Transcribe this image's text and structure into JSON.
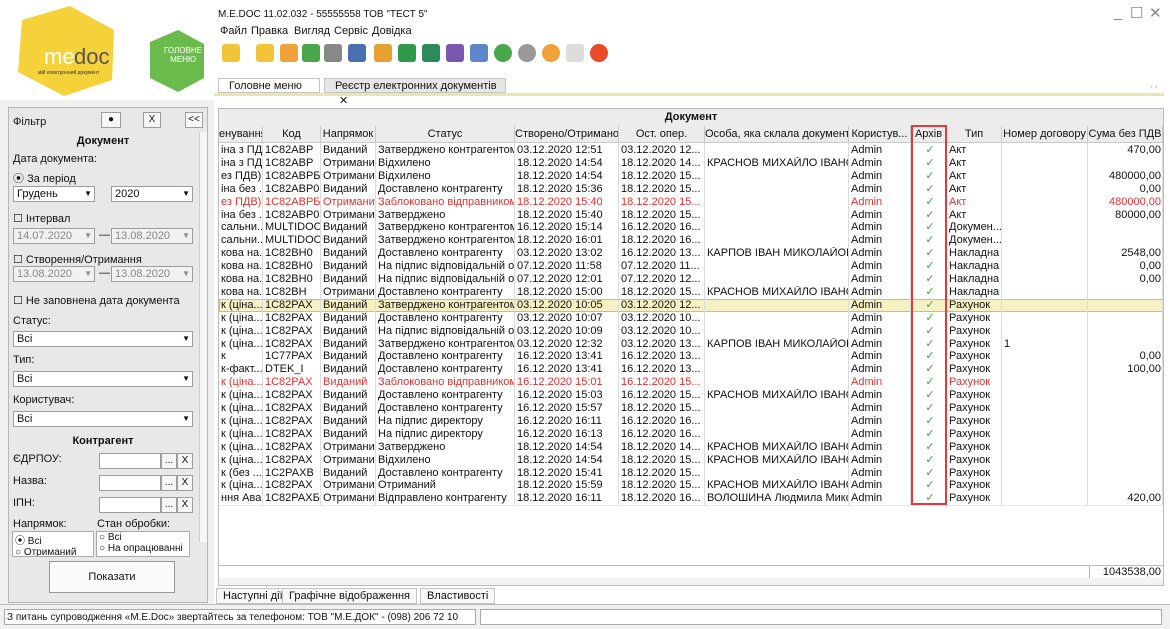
{
  "app": {
    "title": "M.E.DOC 11.02.032 - 55555558 ТОВ \"ТЕСТ 5\"",
    "logo_text": "me doc",
    "logo_sub": "мій електронний документ",
    "main_menu_badge": "ГОЛОВНЕ МЕНЮ"
  },
  "menu": [
    "Файл",
    "Правка",
    "Вигляд",
    "Сервіс",
    "Довідка"
  ],
  "tabs": {
    "main": "Головне меню",
    "registry": "Реєстр електронних документів",
    "close": "✕"
  },
  "filter": {
    "title": "Фільтр",
    "section_doc": "Документ",
    "date_label": "Дата документа:",
    "period_label": "За період",
    "month": "Грудень",
    "year": "2020",
    "interval_label": "Інтервал",
    "interval_from": "14.07.2020",
    "interval_to": "13.08.2020",
    "created_label": "Створення/Отримання",
    "created_from": "13.08.2020",
    "created_to": "13.08.2020",
    "nodate_label": "Не заповнена дата документа",
    "status_label": "Статус:",
    "status_value": "Всі",
    "type_label": "Тип:",
    "type_value": "Всі",
    "user_label": "Користувач:",
    "user_value": "Всі",
    "section_counterparty": "Контрагент",
    "edrpou_label": "ЄДРПОУ:",
    "name_label": "Назва:",
    "ipn_label": "ІПН:",
    "direction_label": "Напрямок:",
    "processing_label": "Стан обробки:",
    "dir_all": "Всі",
    "dir_recv": "Отриманий",
    "proc_all": "Всі",
    "proc_pending": "На опрацюванні",
    "show_button": "Показати",
    "dots": "...",
    "x": "X",
    "collapse": "<<"
  },
  "grid": {
    "group_header": "Документ",
    "columns": [
      "енування",
      "Код",
      "Напрямок",
      "Статус",
      "Створено/Отримано",
      "Ост. опер.",
      "Особа, яка склала документ",
      "Користув...",
      "Архів",
      "Тип",
      "Номер договору",
      "Сума без ПДВ"
    ],
    "rows": [
      {
        "c": [
          "іна з ПД...",
          "1С82АВР",
          "Виданий",
          "Затверджено контрагентом",
          "03.12.2020 12:51",
          "03.12.2020 12...",
          "",
          "Admin",
          "✓",
          "Акт",
          "",
          "470,00"
        ],
        "red": false,
        "sel": false
      },
      {
        "c": [
          "іна з ПД...",
          "1С82АВР",
          "Отриманий",
          "Відхилено",
          "18.12.2020 14:54",
          "18.12.2020 14...",
          "КРАСНОВ МИХАЙЛО ІВАНО...",
          "Admin",
          "✓",
          "Акт",
          "",
          ""
        ],
        "red": false,
        "sel": false
      },
      {
        "c": [
          "ез ПДВ)",
          "1С82АВРБ",
          "Отриманий",
          "Відхилено",
          "18.12.2020 14:54",
          "18.12.2020 15...",
          "",
          "Admin",
          "✓",
          "Акт",
          "",
          "480000,00"
        ],
        "red": false,
        "sel": false
      },
      {
        "c": [
          "іна без ...",
          "1С82АВР0",
          "Виданий",
          "Доставлено контрагенту",
          "18.12.2020 15:36",
          "18.12.2020 15...",
          "",
          "Admin",
          "✓",
          "Акт",
          "",
          "0,00"
        ],
        "red": false,
        "sel": false
      },
      {
        "c": [
          "ез ПДВ)",
          "1С82АВРБ",
          "Отриманий",
          "Заблоковано відправником",
          "18.12.2020 15:40",
          "18.12.2020 15...",
          "",
          "Admin",
          "✓",
          "Акт",
          "",
          "480000,00"
        ],
        "red": true,
        "sel": false
      },
      {
        "c": [
          "іна без ...",
          "1С82АВР0",
          "Отриманий",
          "Затверджено",
          "18.12.2020 15:40",
          "18.12.2020 15...",
          "",
          "Admin",
          "✓",
          "Акт",
          "",
          "80000,00"
        ],
        "red": false,
        "sel": false
      },
      {
        "c": [
          "сальни...",
          "MULTIDOC",
          "Виданий",
          "Затверджено контрагентом",
          "16.12.2020 15:14",
          "16.12.2020 16...",
          "",
          "Admin",
          "✓",
          "Докумен...",
          "",
          ""
        ],
        "red": false,
        "sel": false
      },
      {
        "c": [
          "сальни...",
          "MULTIDOC",
          "Виданий",
          "Затверджено контрагентом",
          "18.12.2020 16:01",
          "18.12.2020 16...",
          "",
          "Admin",
          "✓",
          "Докумен...",
          "",
          ""
        ],
        "red": false,
        "sel": false
      },
      {
        "c": [
          "кова на...",
          "1С82ВН0",
          "Виданий",
          "Доставлено контрагенту",
          "03.12.2020 13:02",
          "16.12.2020 13...",
          "КАРПОВ ІВАН МИКОЛАЙОВИЧ",
          "Admin",
          "✓",
          "Накладна",
          "",
          "2548,00"
        ],
        "red": false,
        "sel": false
      },
      {
        "c": [
          "кова на...",
          "1С82ВН0",
          "Виданий",
          "На підпис відповідальній ос...",
          "07.12.2020 11:58",
          "07.12.2020 11...",
          "",
          "Admin",
          "✓",
          "Накладна",
          "",
          "0,00"
        ],
        "red": false,
        "sel": false
      },
      {
        "c": [
          "кова на...",
          "1С82ВН0",
          "Виданий",
          "На підпис відповідальній ос...",
          "07.12.2020 12:01",
          "07.12.2020 12...",
          "",
          "Admin",
          "✓",
          "Накладна",
          "",
          "0,00"
        ],
        "red": false,
        "sel": false
      },
      {
        "c": [
          "кова на...",
          "1С82ВН",
          "Отриманий",
          "Доставлено контрагенту",
          "18.12.2020 15:00",
          "18.12.2020 15...",
          "КРАСНОВ МИХАЙЛО ІВАНО...",
          "Admin",
          "✓",
          "Накладна",
          "",
          ""
        ],
        "red": false,
        "sel": false
      },
      {
        "c": [
          "к (ціна...",
          "1С82РАХ",
          "Виданий",
          "Затверджено контрагентом",
          "03.12.2020 10:05",
          "03.12.2020 12...",
          "",
          "Admin",
          "✓",
          "Рахунок",
          "",
          ""
        ],
        "red": false,
        "sel": true
      },
      {
        "c": [
          "к (ціна...",
          "1С82РАХ",
          "Виданий",
          "Доставлено контрагенту",
          "03.12.2020 10:07",
          "03.12.2020 10...",
          "",
          "Admin",
          "✓",
          "Рахунок",
          "",
          ""
        ],
        "red": false,
        "sel": false
      },
      {
        "c": [
          "к (ціна...",
          "1С82РАХ",
          "Виданий",
          "На підпис відповідальній ос...",
          "03.12.2020 10:09",
          "03.12.2020 10...",
          "",
          "Admin",
          "✓",
          "Рахунок",
          "",
          ""
        ],
        "red": false,
        "sel": false
      },
      {
        "c": [
          "к (ціна...",
          "1С82РАХ",
          "Виданий",
          "Затверджено контрагентом",
          "03.12.2020 12:32",
          "03.12.2020 13...",
          "КАРПОВ ІВАН МИКОЛАЙОВИЧ",
          "Admin",
          "✓",
          "Рахунок",
          "1",
          ""
        ],
        "red": false,
        "sel": false
      },
      {
        "c": [
          "к",
          "1С77РАХ",
          "Виданий",
          "Доставлено контрагенту",
          "16.12.2020 13:41",
          "16.12.2020 13...",
          "",
          "Admin",
          "✓",
          "Рахунок",
          "",
          "0,00"
        ],
        "red": false,
        "sel": false
      },
      {
        "c": [
          "к-факт...",
          "DTEK_I",
          "Виданий",
          "Доставлено контрагенту",
          "16.12.2020 13:41",
          "16.12.2020 13...",
          "",
          "Admin",
          "✓",
          "Рахунок",
          "",
          "100,00"
        ],
        "red": false,
        "sel": false
      },
      {
        "c": [
          "к (ціна...",
          "1С82РАХ",
          "Виданий",
          "Заблоковано відправником",
          "16.12.2020 15:01",
          "16.12.2020 15...",
          "",
          "Admin",
          "✓",
          "Рахунок",
          "",
          ""
        ],
        "red": true,
        "sel": false
      },
      {
        "c": [
          "к (ціна...",
          "1С82РАХ",
          "Виданий",
          "Доставлено контрагенту",
          "16.12.2020 15:03",
          "16.12.2020 15...",
          "КРАСНОВ МИХАЙЛО ІВАНО...",
          "Admin",
          "✓",
          "Рахунок",
          "",
          ""
        ],
        "red": false,
        "sel": false
      },
      {
        "c": [
          "к (ціна...",
          "1С82РАХ",
          "Виданий",
          "Доставлено контрагенту",
          "16.12.2020 15:57",
          "18.12.2020 15...",
          "",
          "Admin",
          "✓",
          "Рахунок",
          "",
          ""
        ],
        "red": false,
        "sel": false
      },
      {
        "c": [
          "к (ціна...",
          "1С82РАХ",
          "Виданий",
          "На підпис директору",
          "16.12.2020 16:11",
          "16.12.2020 16...",
          "",
          "Admin",
          "✓",
          "Рахунок",
          "",
          ""
        ],
        "red": false,
        "sel": false
      },
      {
        "c": [
          "к (ціна...",
          "1С82РАХ",
          "Виданий",
          "На підпис директору",
          "16.12.2020 16:13",
          "16.12.2020 16...",
          "",
          "Admin",
          "✓",
          "Рахунок",
          "",
          ""
        ],
        "red": false,
        "sel": false
      },
      {
        "c": [
          "к (ціна...",
          "1С82РАХ",
          "Отриманий",
          "Затверджено",
          "18.12.2020 14:54",
          "18.12.2020 14...",
          "КРАСНОВ МИХАЙЛО ІВАНО...",
          "Admin",
          "✓",
          "Рахунок",
          "",
          ""
        ],
        "red": false,
        "sel": false
      },
      {
        "c": [
          "к (ціна...",
          "1С82РАХ",
          "Отриманий",
          "Відхилено",
          "18.12.2020 14:54",
          "18.12.2020 15...",
          "КРАСНОВ МИХАЙЛО ІВАНО...",
          "Admin",
          "✓",
          "Рахунок",
          "",
          ""
        ],
        "red": false,
        "sel": false
      },
      {
        "c": [
          "к (без ...",
          "1С2РАХВ",
          "Виданий",
          "Доставлено контрагенту",
          "18.12.2020 15:41",
          "18.12.2020 15...",
          "",
          "Admin",
          "✓",
          "Рахунок",
          "",
          ""
        ],
        "red": false,
        "sel": false
      },
      {
        "c": [
          "к (ціна...",
          "1С82РАХ",
          "Отриманий",
          "Отриманий",
          "18.12.2020 15:59",
          "18.12.2020 15...",
          "КРАСНОВ МИХАЙЛО ІВАНО...",
          "Admin",
          "✓",
          "Рахунок",
          "",
          ""
        ],
        "red": false,
        "sel": false
      },
      {
        "c": [
          "ння Ава...",
          "1С82РАХБ",
          "Отриманий",
          "Відправлено контрагенту",
          "18.12.2020 16:11",
          "18.12.2020 16...",
          "ВОЛОШИНА Людмила Мико...",
          "Admin",
          "✓",
          "Рахунок",
          "",
          "420,00"
        ],
        "red": false,
        "sel": false
      }
    ],
    "total": "1043538,00"
  },
  "bottom_tabs": [
    "Наступні дії",
    "Графічне відображення",
    "Властивості"
  ],
  "status": "З питань супроводження «M.E.Doc» звертайтесь за телефоном: ТОВ \"М.Е.ДОК\" - (098) 206 72 10",
  "colors": {
    "accent_yellow": "#f6d23a",
    "logo_green": "#5cb84a",
    "red_text": "#e53030",
    "selected_row": "#f6f1c4",
    "check_green": "#3aa23a"
  }
}
